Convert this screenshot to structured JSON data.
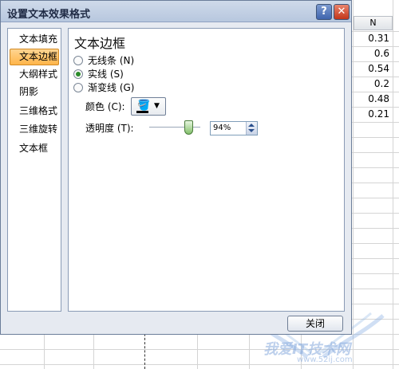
{
  "dialog": {
    "title": "设置文本效果格式",
    "help_button": "?",
    "close_x": "✕",
    "close_button": "关闭"
  },
  "categories": [
    {
      "label": "文本填充",
      "selected": false
    },
    {
      "label": "文本边框",
      "selected": true
    },
    {
      "label": "大纲样式",
      "selected": false
    },
    {
      "label": "阴影",
      "selected": false
    },
    {
      "label": "三维格式",
      "selected": false
    },
    {
      "label": "三维旋转",
      "selected": false
    },
    {
      "label": "文本框",
      "selected": false
    }
  ],
  "panel": {
    "title": "文本边框",
    "options": [
      {
        "label": "无线条 (N)",
        "checked": false
      },
      {
        "label": "实线 (S)",
        "checked": true
      },
      {
        "label": "渐变线 (G)",
        "checked": false
      }
    ],
    "color_label": "颜色 (C):",
    "color_value": "#000000",
    "color_icon": "paint-bucket-icon",
    "transparency_label": "透明度 (T):",
    "transparency_value": "94%",
    "transparency_level": 0.94
  },
  "sheet": {
    "column_header": "N",
    "cells": [
      "0.31",
      "0.6",
      "0.54",
      "0.2",
      "0.48",
      "0.21"
    ]
  },
  "watermark": {
    "text": "我爱IT技术网",
    "url": "www.52ij.com"
  }
}
